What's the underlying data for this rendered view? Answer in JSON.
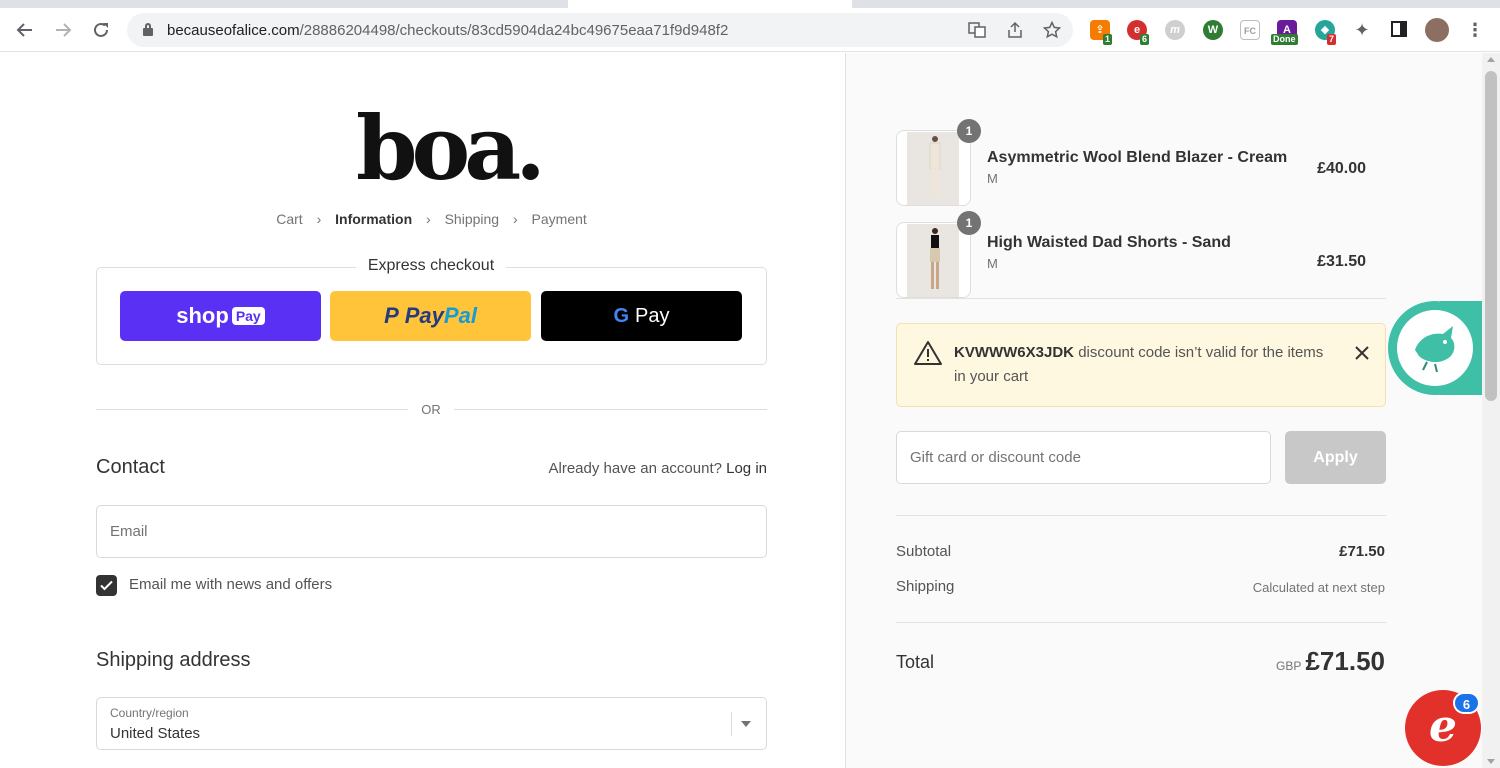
{
  "browser": {
    "url_host": "becauseofalice.com",
    "url_path": "/28886204498/checkouts/83cd5904da24bc49675eaa71f9d948f2",
    "extensions": [
      {
        "name": "extension-1",
        "badge": "1",
        "color": "#f57c00"
      },
      {
        "name": "extension-2",
        "badge": "6",
        "color": "#d32f2f"
      },
      {
        "name": "extension-3",
        "badge": "",
        "color": "#bdbdbd"
      },
      {
        "name": "extension-4",
        "badge": "",
        "color": "#2e7d32"
      },
      {
        "name": "extension-fc",
        "label": "FC",
        "badge": "",
        "color": "#9e9e9e"
      },
      {
        "name": "extension-done",
        "badge": "Done",
        "color": "#6a1b9a"
      },
      {
        "name": "extension-7",
        "badge": "7",
        "color": "#26a69a"
      }
    ]
  },
  "checkout": {
    "logo": "boa.",
    "breadcrumb": {
      "cart": "Cart",
      "information": "Information",
      "shipping": "Shipping",
      "payment": "Payment"
    },
    "express_title": "Express checkout",
    "shoppay": {
      "shop": "shop",
      "pay": "Pay"
    },
    "paypal": {
      "p1": "Pay",
      "p2": "Pal"
    },
    "gpay": {
      "g": "G",
      "pay": "Pay"
    },
    "or": "OR",
    "contact": {
      "heading": "Contact",
      "login_prompt": "Already have an account?",
      "login_link": "Log in",
      "email_placeholder": "Email",
      "newsletter_label": "Email me with news and offers",
      "newsletter_checked": true
    },
    "shipping_address": {
      "heading": "Shipping address",
      "country_label": "Country/region",
      "country_value": "United States"
    }
  },
  "summary": {
    "items": [
      {
        "name": "Asymmetric Wool Blend Blazer - Cream",
        "variant": "M",
        "price": "£40.00",
        "qty": "1"
      },
      {
        "name": "High Waisted Dad Shorts - Sand",
        "variant": "M",
        "price": "£31.50",
        "qty": "1"
      }
    ],
    "banner": {
      "code": "KVWWW6X3JDK",
      "message": "discount code isn’t valid for the items in your cart"
    },
    "discount_placeholder": "Gift card or discount code",
    "apply_label": "Apply",
    "subtotal_label": "Subtotal",
    "subtotal_value": "£71.50",
    "shipping_label": "Shipping",
    "shipping_value": "Calculated at next step",
    "total_label": "Total",
    "currency": "GBP",
    "total_value": "£71.50"
  },
  "widgets": {
    "help_badge": "6"
  },
  "colors": {
    "shoppay": "#5a31f4",
    "paypal": "#ffc439",
    "gpay": "#000000",
    "banner_bg": "#fff8e1",
    "chat_widget": "#3fbfa6",
    "help_bubble": "#e2312a"
  }
}
